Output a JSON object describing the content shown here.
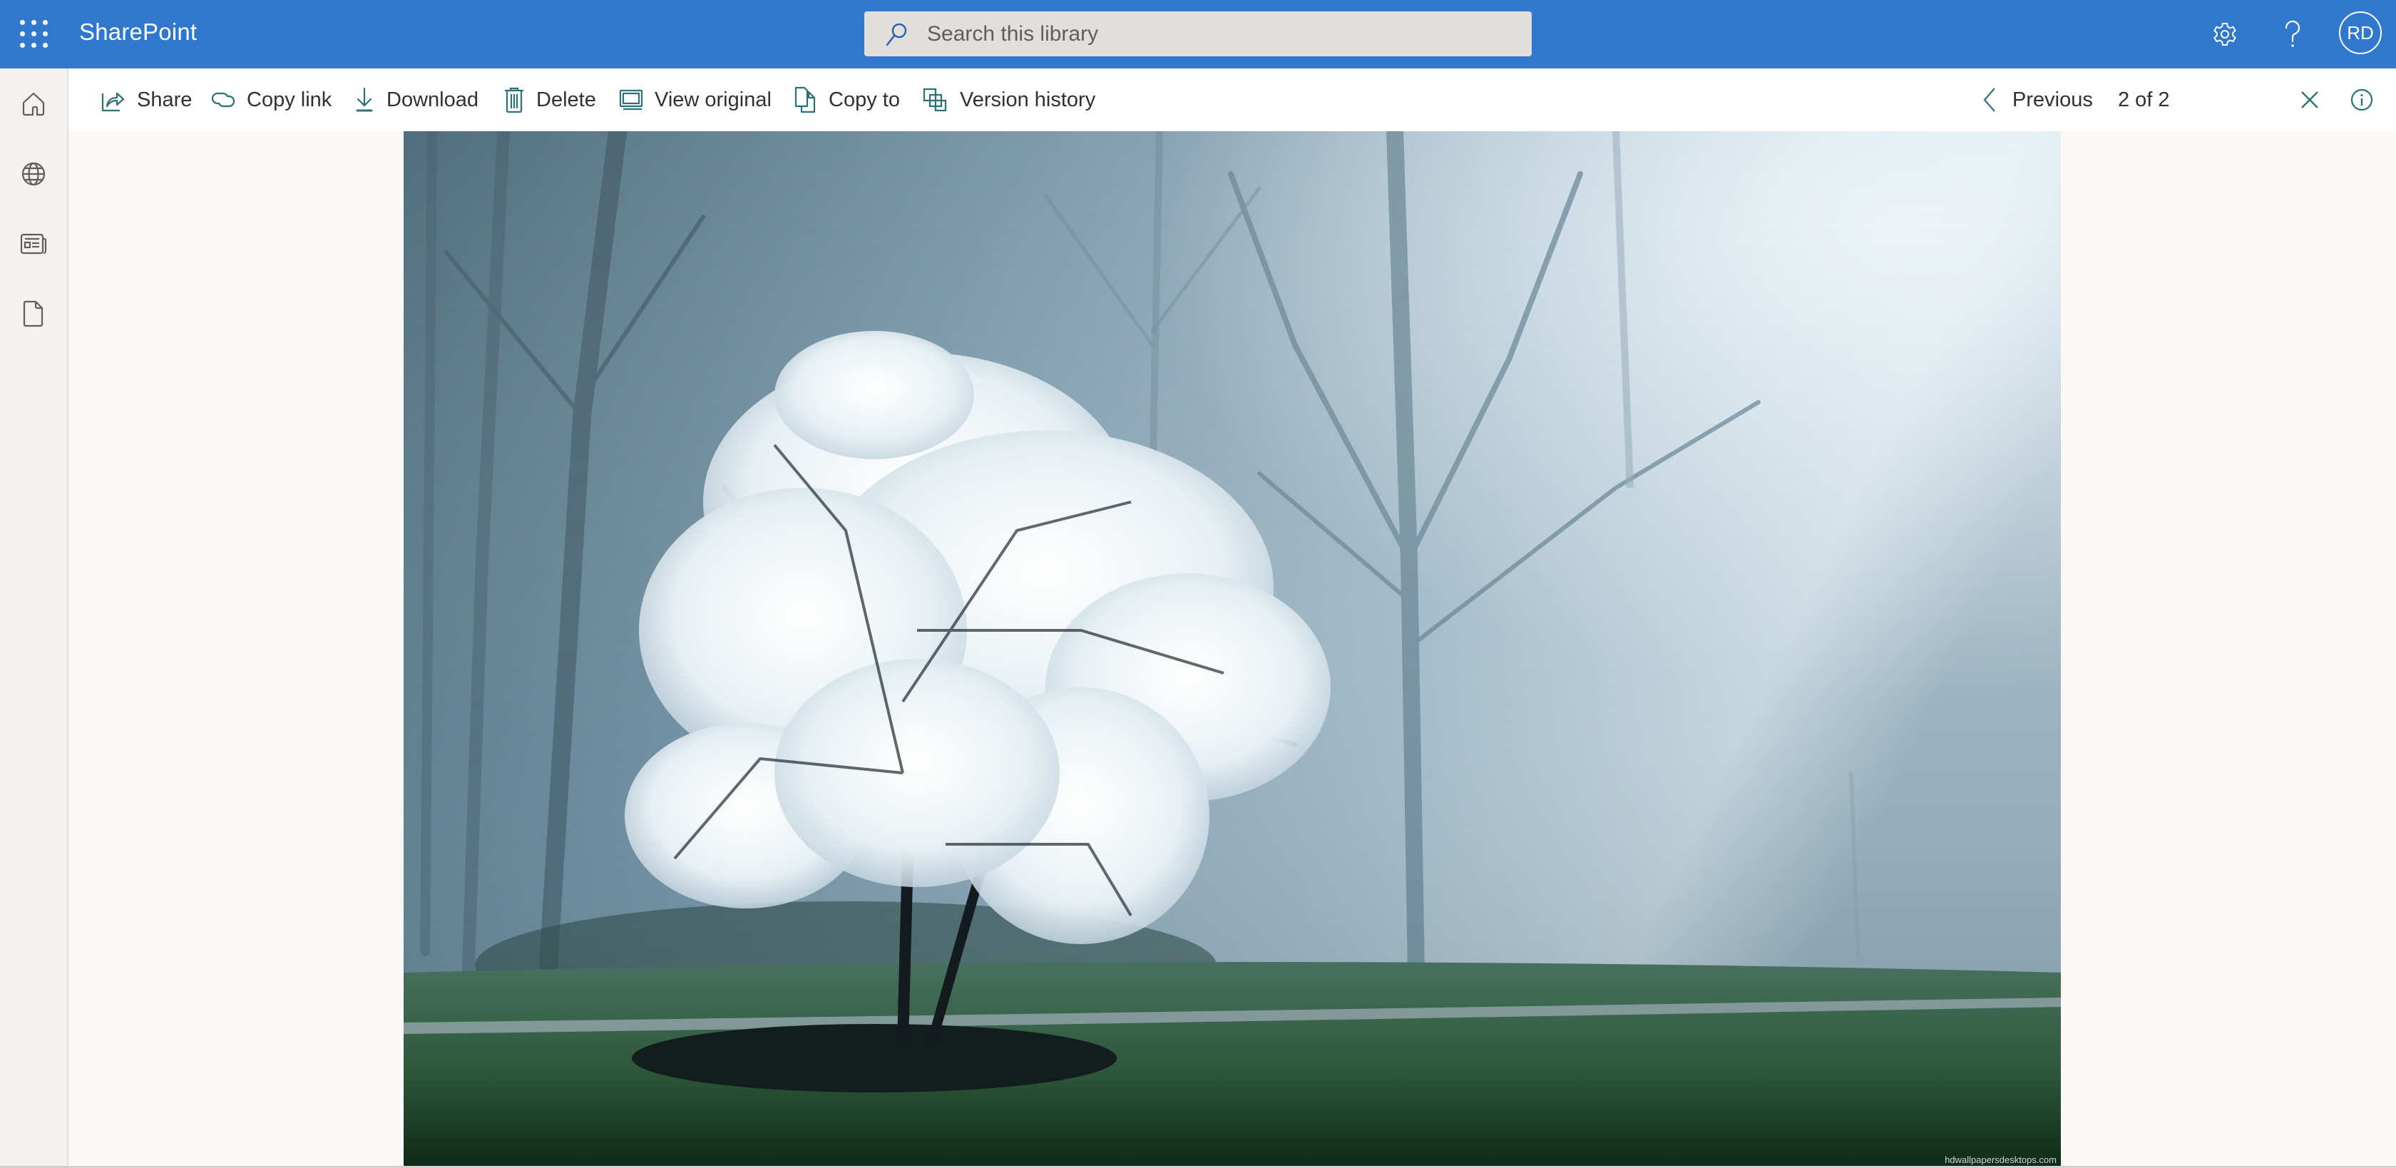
{
  "app": {
    "brand": "SharePoint",
    "accent_color": "#3078cd",
    "icon_color": "#2c7075",
    "waffle_icon": "app-launcher-icon"
  },
  "header": {
    "search": {
      "placeholder": "Search this library",
      "value": ""
    },
    "icons": [
      "settings-icon",
      "help-icon"
    ],
    "avatar_initials": "RD"
  },
  "rail": {
    "items": [
      {
        "name": "home",
        "icon": "home-icon"
      },
      {
        "name": "sites",
        "icon": "globe-icon"
      },
      {
        "name": "news",
        "icon": "news-icon"
      },
      {
        "name": "files",
        "icon": "document-icon"
      }
    ]
  },
  "toolbar": {
    "actions": [
      {
        "label": "Share",
        "icon": "share-icon"
      },
      {
        "label": "Copy link",
        "icon": "link-icon"
      },
      {
        "label": "Download",
        "icon": "download-icon"
      },
      {
        "label": "Delete",
        "icon": "trash-icon"
      },
      {
        "label": "View original",
        "icon": "view-original-icon"
      },
      {
        "label": "Copy to",
        "icon": "copy-icon"
      },
      {
        "label": "Version history",
        "icon": "version-history-icon"
      }
    ],
    "previous_label": "Previous",
    "counter": "2 of 2"
  },
  "viewer": {
    "image_description": "White blossoming tree in misty forest park",
    "watermark": "hdwallpapersdesktops.com"
  }
}
